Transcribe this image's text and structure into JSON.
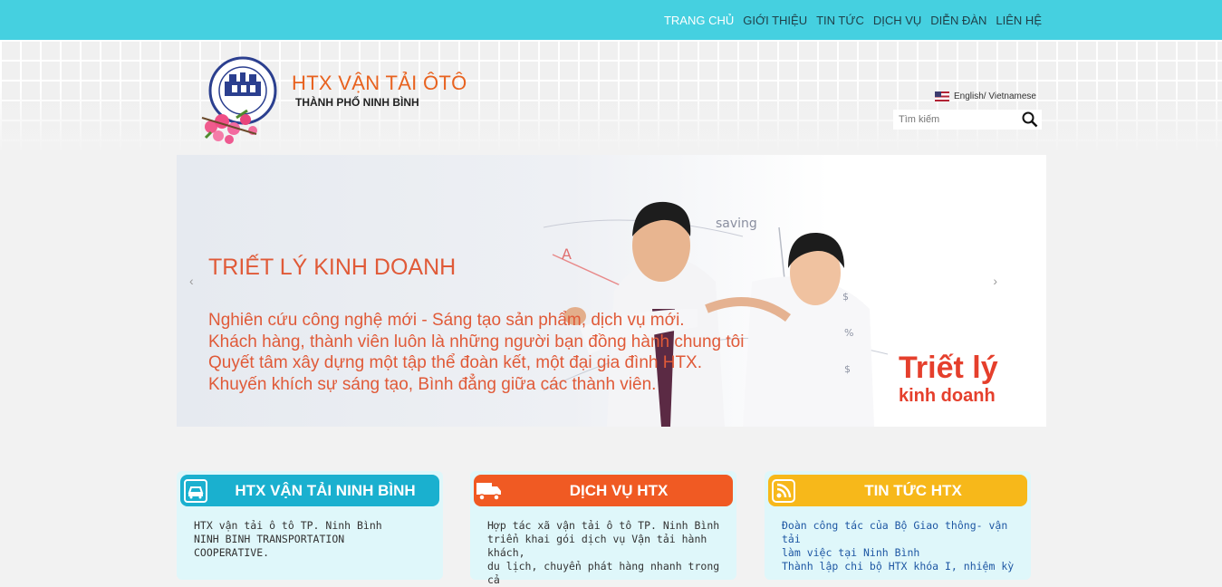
{
  "nav": {
    "items": [
      "TRANG CHỦ",
      "GIỚI THIỆU",
      "TIN TỨC",
      "DỊCH VỤ",
      "DIỄN ĐÀN",
      "LIÊN HỆ"
    ]
  },
  "header": {
    "title": "HTX VẬN TẢI ÔTÔ",
    "subtitle": "THÀNH PHỐ NINH BÌNH",
    "language": "English/ Vietnamese",
    "search_placeholder": "Tìm kiếm"
  },
  "banner": {
    "title": "TRIẾT LÝ KINH DOANH",
    "lines": [
      "Nghiên cứu công nghệ mới - Sáng tạo sản phẩm, dịch vụ mới.",
      "Khách hàng, thành viên luôn là những người bạn đồng hành chung tôi",
      "Quyết tâm xây dựng một tập thể đoàn kết, một đại gia đình HTX.",
      "Khuyến khích sự sáng tạo, Bình đẳng giữa các thành viên."
    ],
    "stamp_line1": "Triết lý",
    "stamp_line2": "kinh doanh"
  },
  "cards": [
    {
      "title": "HTX VẬN TẢI NINH BÌNH",
      "color": "#1ab0cf",
      "icon": "car-icon",
      "lines": [
        "HTX vận tải ô tô TP. Ninh Bình",
        "NINH BINH TRANSPORTATION",
        "COOPERATIVE."
      ]
    },
    {
      "title": "DỊCH VỤ HTX",
      "color": "#f05a23",
      "icon": "truck-icon",
      "lines": [
        "Hợp tác xã vận tải ô tô TP. Ninh Bình",
        "triển khai gói dịch vụ Vận tải hành khách,",
        "du lịch, chuyển phát hàng nhanh trong cả"
      ]
    },
    {
      "title": "TIN TỨC HTX",
      "color": "#f7b81a",
      "icon": "rss-icon",
      "lines": [
        "Đoàn công tác của Bộ Giao thông- vận tải",
        "làm việc tại Ninh Bình",
        "Thành lập chi bộ HTX khóa I, nhiệm kỳ"
      ]
    }
  ]
}
